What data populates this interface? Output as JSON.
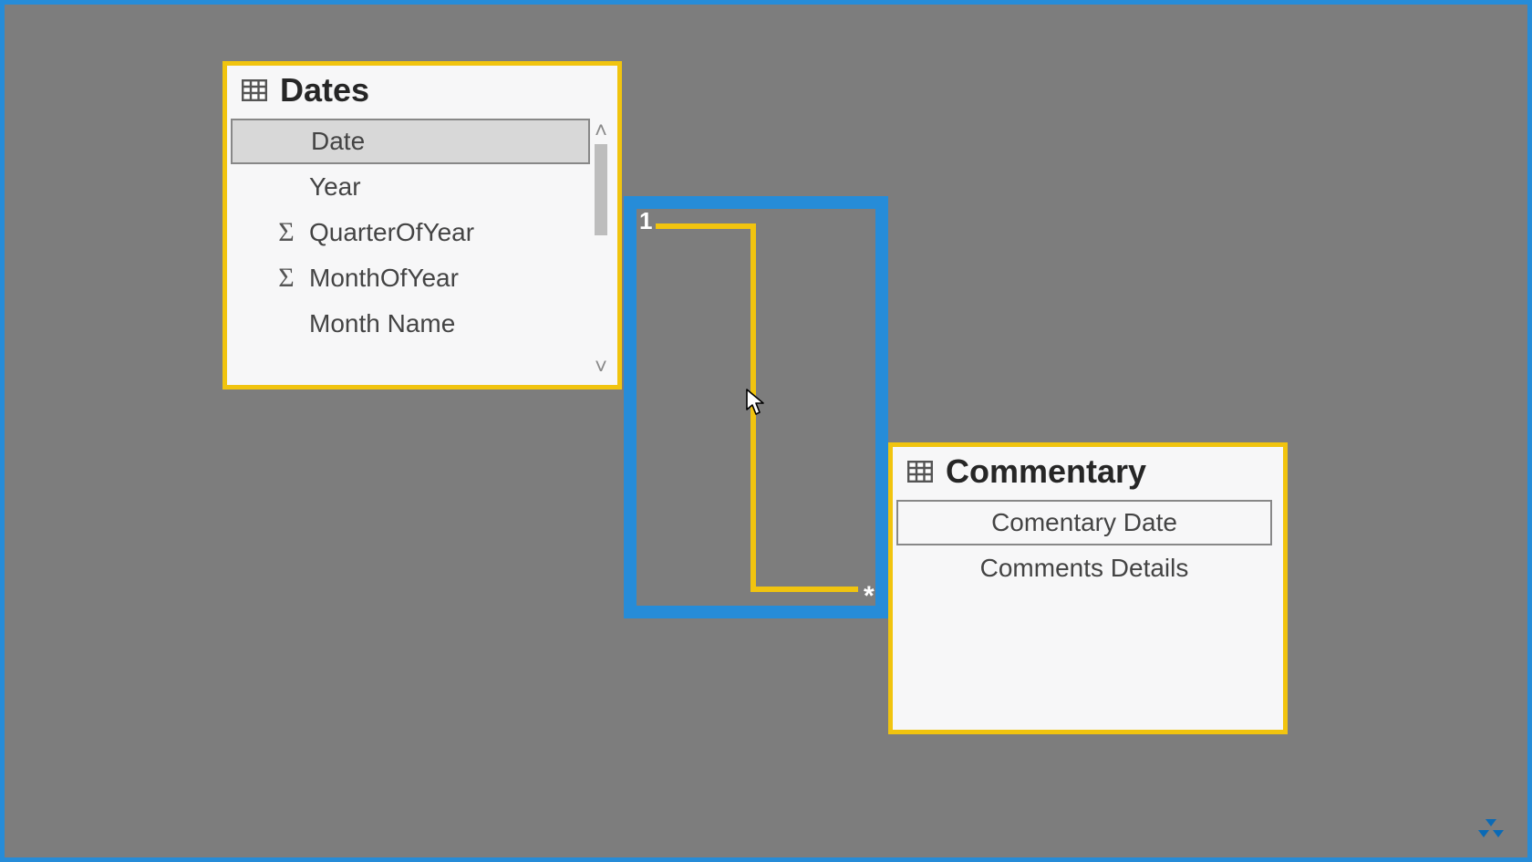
{
  "colors": {
    "highlight": "#f1c40f",
    "accent": "#268cd8"
  },
  "tables": {
    "dates": {
      "title": "Dates",
      "fields": [
        {
          "label": "Date",
          "kind": "column",
          "selected": true
        },
        {
          "label": "Year",
          "kind": "column",
          "selected": false
        },
        {
          "label": "QuarterOfYear",
          "kind": "measure",
          "selected": false
        },
        {
          "label": "MonthOfYear",
          "kind": "measure",
          "selected": false
        },
        {
          "label": "Month Name",
          "kind": "column",
          "selected": false
        }
      ]
    },
    "commentary": {
      "title": "Commentary",
      "fields": [
        {
          "label": "Comentary Date",
          "kind": "column",
          "selected": false,
          "framed": true
        },
        {
          "label": "Comments Details",
          "kind": "column",
          "selected": false
        }
      ]
    }
  },
  "relationship": {
    "from_cardinality": "1",
    "to_cardinality": "*"
  }
}
